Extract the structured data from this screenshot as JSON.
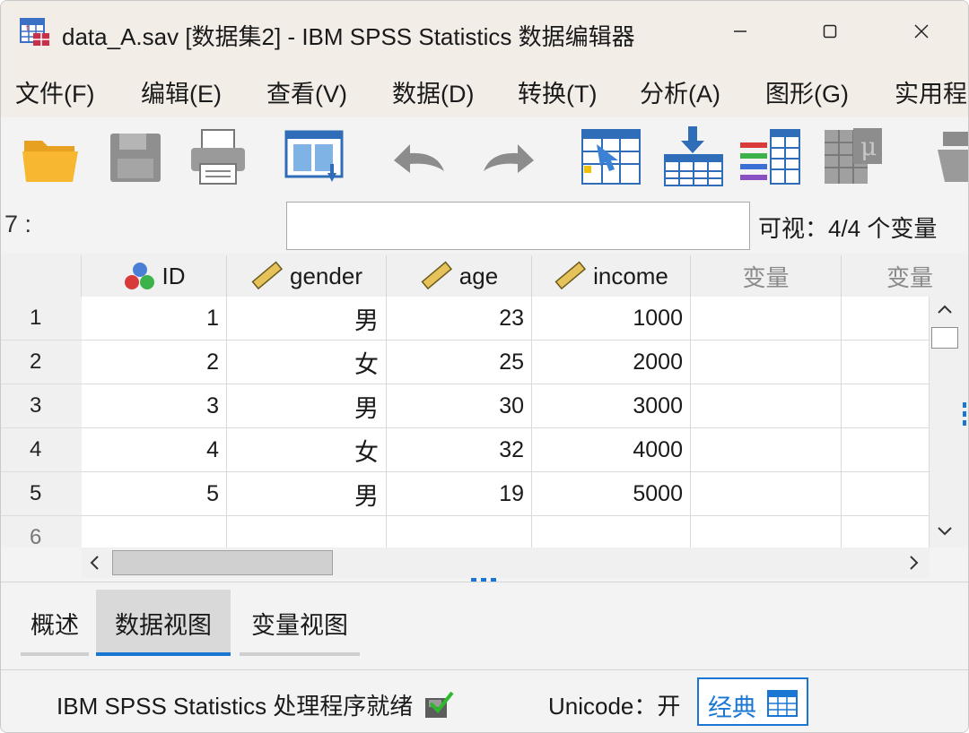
{
  "window": {
    "title": "data_A.sav [数据集2] - IBM SPSS Statistics 数据编辑器",
    "minimize_icon": "minimize-icon",
    "maximize_icon": "maximize-icon",
    "close_icon": "close-icon"
  },
  "menu": {
    "items": [
      {
        "label": "文件(F)"
      },
      {
        "label": "编辑(E)"
      },
      {
        "label": "查看(V)"
      },
      {
        "label": "数据(D)"
      },
      {
        "label": "转换(T)"
      },
      {
        "label": "分析(A)"
      },
      {
        "label": "图形(G)"
      },
      {
        "label": "实用程"
      }
    ]
  },
  "toolbar": {
    "icons": [
      "open-folder-icon",
      "save-icon",
      "print-icon",
      "recall-dialog-icon",
      "undo-icon",
      "redo-icon",
      "goto-case-icon",
      "insert-cases-icon",
      "variables-icon",
      "descriptives-icon",
      "split-file-icon"
    ]
  },
  "editor": {
    "cell_ref": "7 :",
    "cell_value": "",
    "visible_label": "可视：4/4 个变量"
  },
  "grid": {
    "columns": [
      {
        "name": "ID",
        "icon": "nominal-icon"
      },
      {
        "name": "gender",
        "icon": "scale-icon"
      },
      {
        "name": "age",
        "icon": "scale-icon"
      },
      {
        "name": "income",
        "icon": "scale-icon"
      },
      {
        "name": "变量",
        "icon": ""
      },
      {
        "name": "变量",
        "icon": ""
      }
    ],
    "rows": [
      {
        "num": "1",
        "cells": [
          "1",
          "男",
          "23",
          "1000"
        ]
      },
      {
        "num": "2",
        "cells": [
          "2",
          "女",
          "25",
          "2000"
        ]
      },
      {
        "num": "3",
        "cells": [
          "3",
          "男",
          "30",
          "3000"
        ]
      },
      {
        "num": "4",
        "cells": [
          "4",
          "女",
          "32",
          "4000"
        ]
      },
      {
        "num": "5",
        "cells": [
          "5",
          "男",
          "19",
          "5000"
        ]
      },
      {
        "num": "6",
        "cells": [
          "",
          "",
          "",
          ""
        ]
      }
    ]
  },
  "tabs": [
    {
      "label": "概述",
      "active": false
    },
    {
      "label": "数据视图",
      "active": true
    },
    {
      "label": "变量视图",
      "active": false
    }
  ],
  "status": {
    "processor": "IBM SPSS Statistics 处理程序就绪",
    "unicode": "Unicode：开",
    "mode": "经典"
  },
  "colors": {
    "accent": "#1976d2",
    "titlebar_bg": "#f3ede8"
  }
}
